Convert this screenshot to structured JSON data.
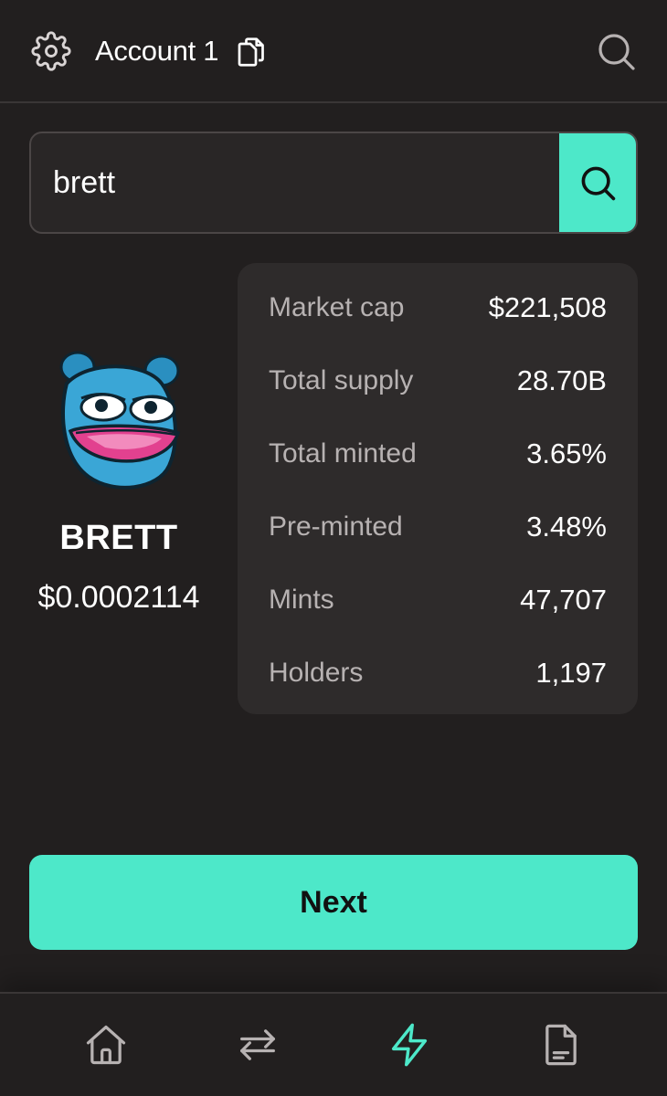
{
  "header": {
    "account_name": "Account 1",
    "icons": [
      "gear-icon",
      "copy-icon",
      "search-icon"
    ]
  },
  "search": {
    "value": "brett",
    "button_icon": "search-icon"
  },
  "token": {
    "symbol": "BRETT",
    "price": "$0.0002114",
    "logo_icon": "brett-logo"
  },
  "stats": [
    {
      "label": "Market cap",
      "value": "$221,508"
    },
    {
      "label": "Total supply",
      "value": "28.70B"
    },
    {
      "label": "Total minted",
      "value": "3.65%"
    },
    {
      "label": "Pre-minted",
      "value": "3.48%"
    },
    {
      "label": "Mints",
      "value": "47,707"
    },
    {
      "label": "Holders",
      "value": "1,197"
    }
  ],
  "next_button": {
    "label": "Next"
  },
  "nav": {
    "items": [
      "home-icon",
      "swap-icon",
      "lightning-icon",
      "document-icon"
    ],
    "active": "lightning-icon"
  },
  "colors": {
    "accent": "#4de8c9",
    "background": "#221f1f",
    "card": "#2e2b2b",
    "muted_text": "#b7b2b2"
  }
}
